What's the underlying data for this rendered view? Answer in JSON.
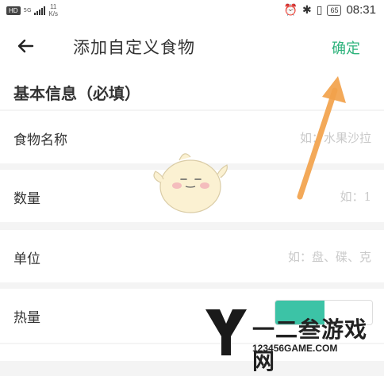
{
  "status_bar": {
    "hd_badge": "HD",
    "network": "5G",
    "speed_value": "11",
    "speed_unit": "K/s",
    "battery": "65",
    "time": "08:31"
  },
  "header": {
    "title": "添加自定义食物",
    "confirm_label": "确定"
  },
  "section": {
    "title": "基本信息（必填）"
  },
  "fields": [
    {
      "label": "食物名称",
      "placeholder": "如：水果沙拉"
    },
    {
      "label": "数量",
      "placeholder": "如：1"
    },
    {
      "label": "单位",
      "placeholder": "如：盘、碟、克"
    },
    {
      "label": "热量",
      "control": "toggle"
    }
  ],
  "watermark": {
    "brand": "一二叁游戏网",
    "url": "123456GAME.COM"
  },
  "colors": {
    "accent": "#2eb37c",
    "toggle_fill": "#3cc3a6",
    "arrow": "#f2a24b"
  }
}
